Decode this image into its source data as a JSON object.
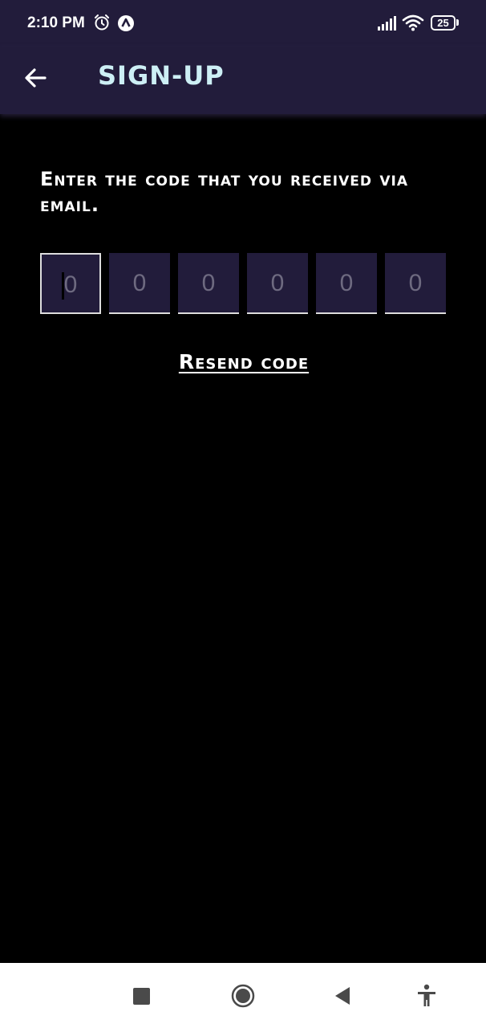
{
  "status_bar": {
    "time": "2:10 PM",
    "battery": "25",
    "icons": [
      "alarm-icon",
      "app-notification-icon",
      "signal-icon",
      "wifi-icon",
      "battery-icon"
    ]
  },
  "app_bar": {
    "title": "SIGN-UP",
    "back_icon": "arrow-left-icon"
  },
  "content": {
    "instructions": "Enter the code that you received via email.",
    "code_digits": [
      "0",
      "0",
      "0",
      "0",
      "0",
      "0"
    ],
    "resend_label": "Resend code"
  },
  "nav_bar": {
    "icons": [
      "recent-apps-icon",
      "home-icon",
      "back-icon",
      "accessibility-icon"
    ]
  },
  "colors": {
    "header_bg": "#221c3b",
    "title_text": "#cdeff5",
    "page_bg": "#000000",
    "input_bg": "#221c3b"
  }
}
